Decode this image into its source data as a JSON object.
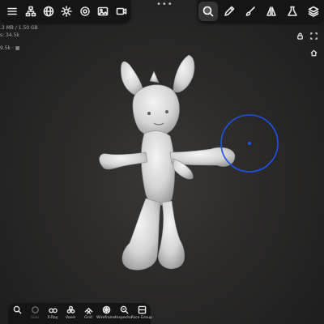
{
  "top_toolbar_left": {
    "icons": [
      "menu-icon",
      "hierarchy-icon",
      "globe-icon",
      "sun-icon",
      "gear-icon",
      "image-icon",
      "video-icon"
    ]
  },
  "top_toolbar_right": {
    "icons": [
      "sculpt-brush-icon",
      "pencil-icon",
      "paint-icon",
      "symmetry-icon",
      "flask-icon",
      "layers-icon"
    ],
    "active_icon": "sculpt-brush-icon"
  },
  "stats": {
    "memory": ".3 MB / 1.50 GB",
    "vertices": "s: 34.5k",
    "faces": "9.5k · ▦"
  },
  "brush_cursor": {
    "color": "#1e52e6"
  },
  "bottom_toolbar": {
    "items": [
      {
        "label": "",
        "icon": "search-icon",
        "dim": false
      },
      {
        "label": "Solo",
        "icon": "solo-icon",
        "dim": true
      },
      {
        "label": "X-Ray",
        "icon": "xray-icon",
        "dim": false
      },
      {
        "label": "Voxel",
        "icon": "voxel-icon",
        "dim": false
      },
      {
        "label": "Grid",
        "icon": "grid-icon",
        "dim": false
      },
      {
        "label": "Wireframe",
        "icon": "wireframe-icon",
        "dim": false
      },
      {
        "label": "Inspector",
        "icon": "inspector-icon",
        "dim": false
      },
      {
        "label": "Face Group",
        "icon": "face-group-icon",
        "dim": false
      }
    ]
  },
  "colors": {
    "toolbar_bg": "#151515",
    "model": "#e6e6e6",
    "accent": "#1e52e6"
  }
}
